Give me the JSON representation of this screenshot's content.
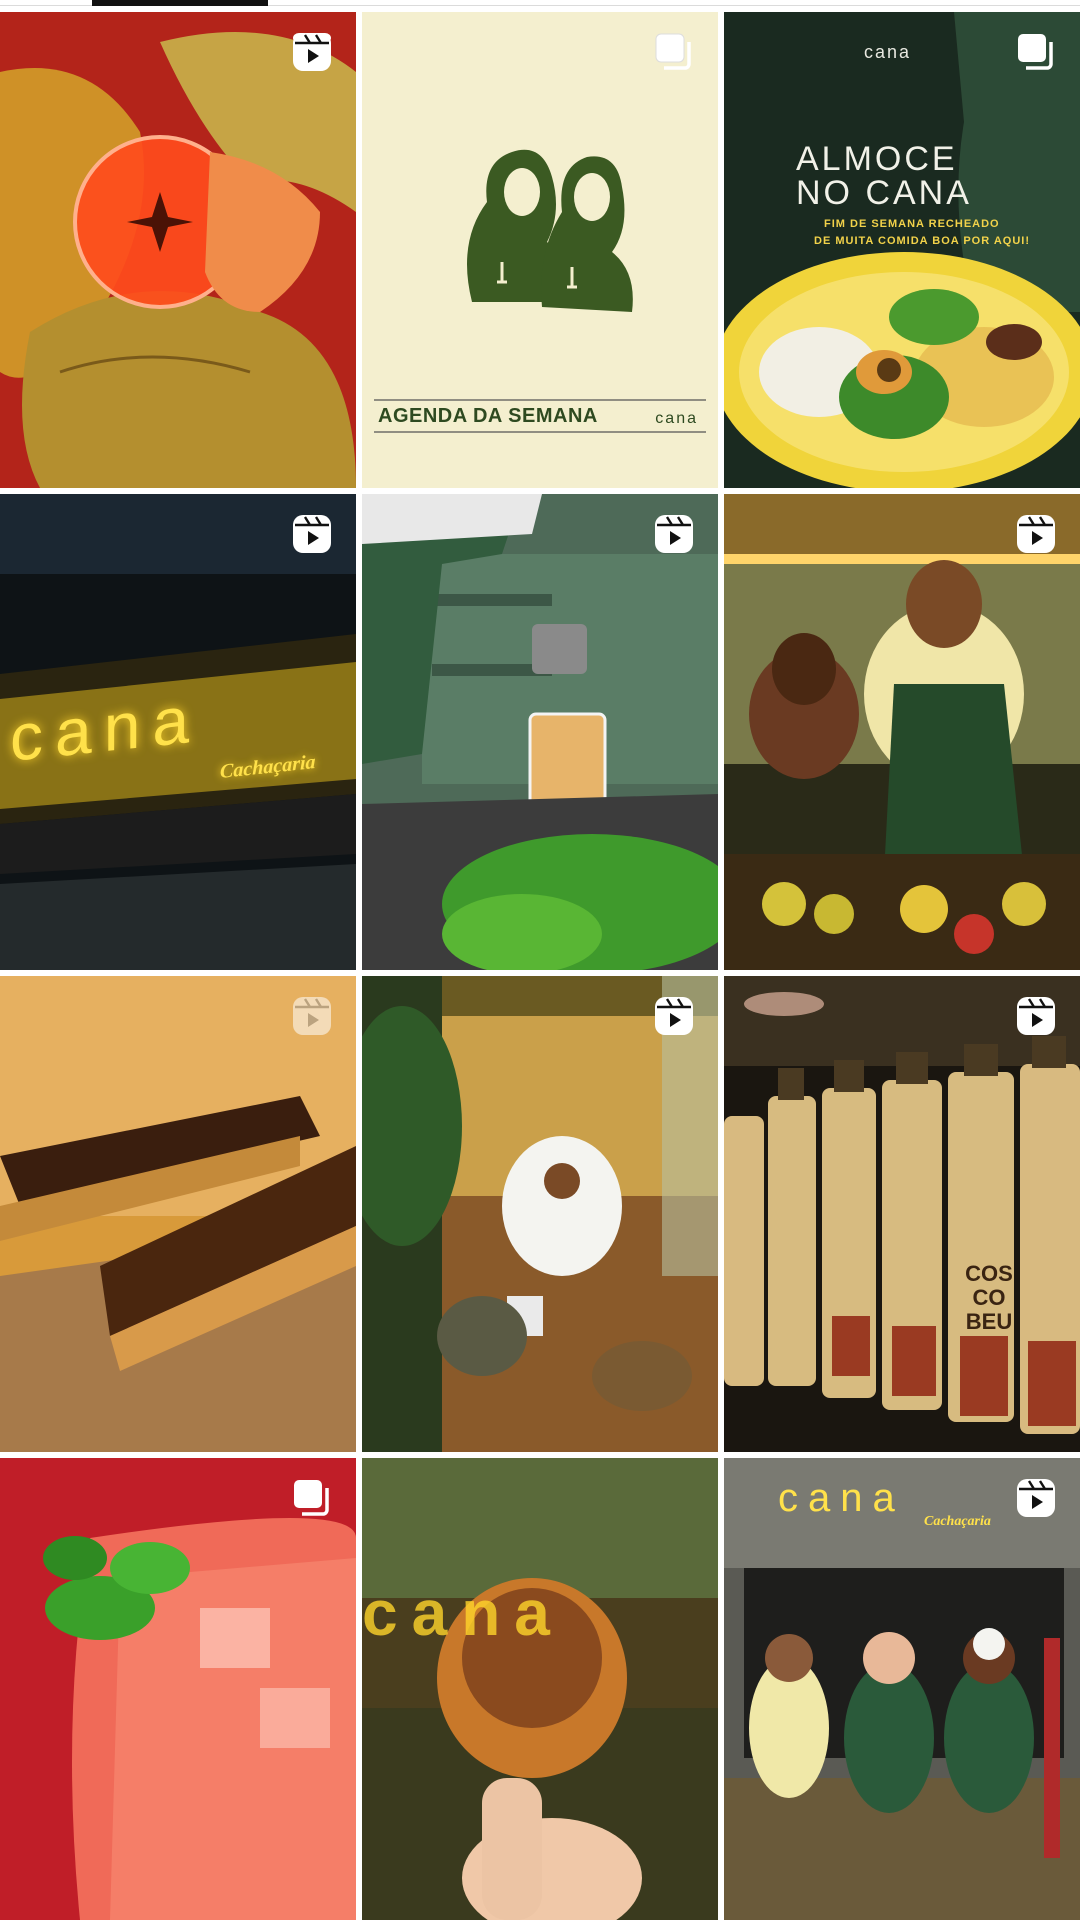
{
  "tabs": {
    "active_index": 0
  },
  "posts": [
    {
      "type": "reel",
      "icon": "reel-icon",
      "alt": ""
    },
    {
      "type": "carousel",
      "icon": "carousel-icon",
      "text": {
        "title": "AGENDA DA SEMANA",
        "logo": "cana"
      }
    },
    {
      "type": "carousel",
      "icon": "carousel-icon",
      "text": {
        "logo": "cana",
        "headline_1": "ALMOCE",
        "headline_2": "NO CANA",
        "line_1": "FIM DE SEMANA RECHEADO",
        "line_2": "DE MUITA COMIDA BOA POR AQUI!"
      }
    },
    {
      "type": "reel",
      "icon": "reel-icon",
      "text": {
        "sign": "cana",
        "script": "Cachaçaria"
      }
    },
    {
      "type": "reel",
      "icon": "reel-icon"
    },
    {
      "type": "reel",
      "icon": "reel-icon"
    },
    {
      "type": "reel",
      "icon": "reel-icon",
      "faded": true
    },
    {
      "type": "reel",
      "icon": "reel-icon"
    },
    {
      "type": "reel",
      "icon": "reel-icon",
      "text": {
        "label": "COS CO BEU"
      }
    },
    {
      "type": "carousel",
      "icon": "carousel-icon"
    },
    {
      "type": "image",
      "icon": "",
      "text": {
        "sign": "cana"
      }
    },
    {
      "type": "reel",
      "icon": "reel-icon",
      "text": {
        "sign": "cana",
        "script": "Cachaçaria"
      }
    }
  ],
  "colors": {
    "cream": "#f4efcf",
    "forest": "#2e4a20",
    "neon": "#ffd52b",
    "red": "#c6202a"
  }
}
